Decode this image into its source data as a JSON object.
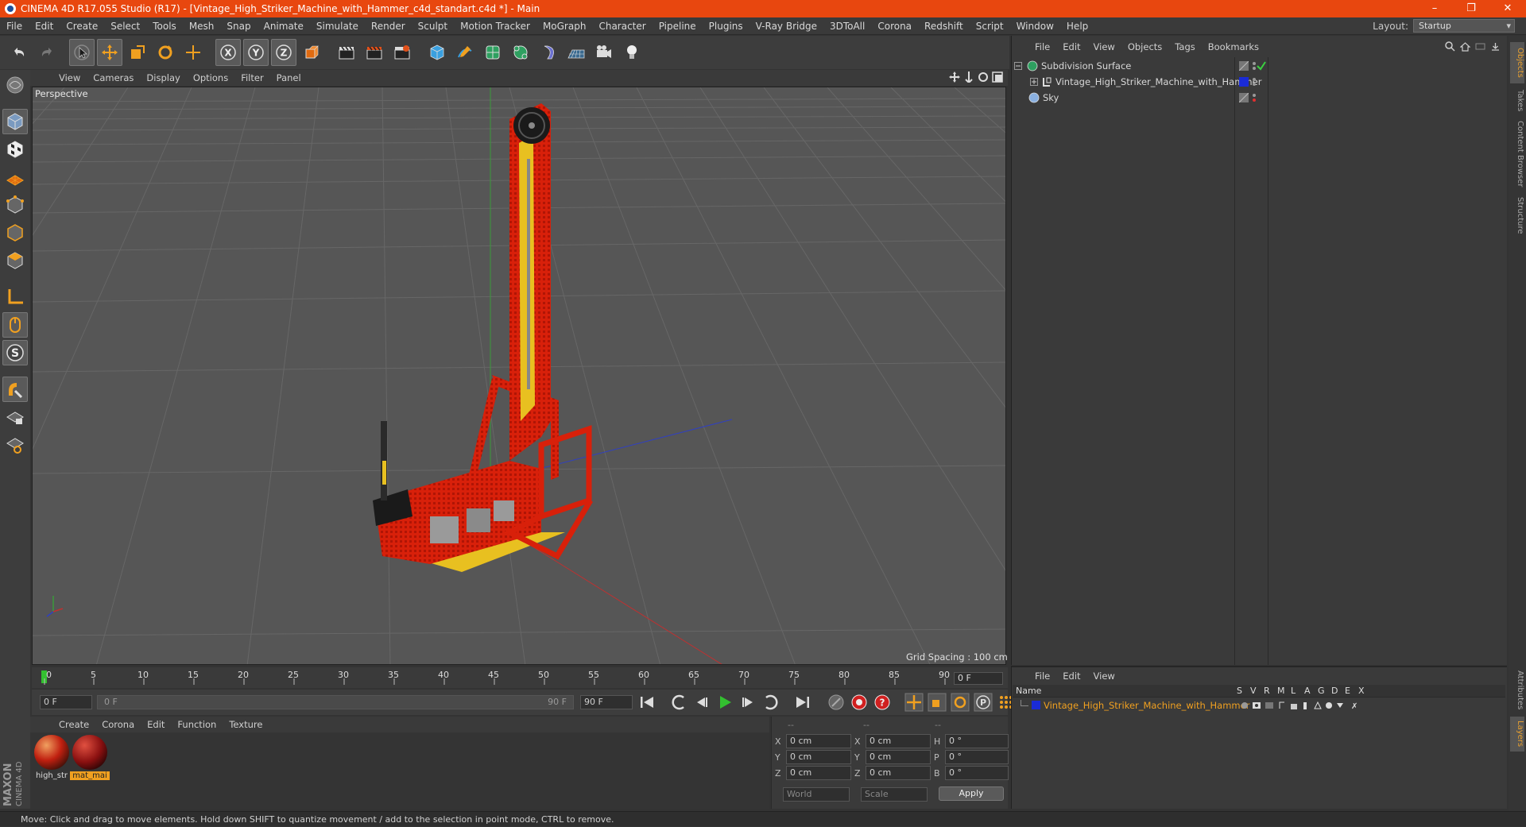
{
  "app": {
    "title": "CINEMA 4D R17.055 Studio (R17) - [Vintage_High_Striker_Machine_with_Hammer_c4d_standart.c4d *] - Main",
    "window_buttons": [
      "–",
      "❐",
      "✕"
    ]
  },
  "menubar": {
    "items": [
      "File",
      "Edit",
      "Create",
      "Select",
      "Tools",
      "Mesh",
      "Snap",
      "Animate",
      "Simulate",
      "Render",
      "Sculpt",
      "Motion Tracker",
      "MoGraph",
      "Character",
      "Pipeline",
      "Plugins",
      "V-Ray Bridge",
      "3DToAll",
      "Corona",
      "Redshift",
      "Script",
      "Window",
      "Help"
    ],
    "layout_label": "Layout:",
    "layout_value": "Startup"
  },
  "viewport": {
    "menu": [
      "View",
      "Cameras",
      "Display",
      "Options",
      "Filter",
      "Panel"
    ],
    "label": "Perspective",
    "grid_spacing": "Grid Spacing : 100 cm"
  },
  "timeline": {
    "ticks": [
      "0",
      "5",
      "10",
      "15",
      "20",
      "25",
      "30",
      "35",
      "40",
      "45",
      "50",
      "55",
      "60",
      "65",
      "70",
      "75",
      "80",
      "85",
      "90"
    ],
    "current_frame": "0 F",
    "start_field": "0 F",
    "range_start": "0 F",
    "range_end": "90 F",
    "end_field": "90 F"
  },
  "materials": {
    "menu": [
      "Create",
      "Corona",
      "Edit",
      "Function",
      "Texture"
    ],
    "items": [
      {
        "name": "high_str"
      },
      {
        "name": "mat_mai"
      }
    ]
  },
  "coordinates": {
    "headers": [
      "--",
      "--",
      "--"
    ],
    "rows": [
      {
        "a": "X",
        "v1": "0 cm",
        "b": "X",
        "v2": "0 cm",
        "c": "H",
        "v3": "0 °"
      },
      {
        "a": "Y",
        "v1": "0 cm",
        "b": "Y",
        "v2": "0 cm",
        "c": "P",
        "v3": "0 °"
      },
      {
        "a": "Z",
        "v1": "0 cm",
        "b": "Z",
        "v2": "0 cm",
        "c": "B",
        "v3": "0 °"
      }
    ],
    "mode1": "World",
    "mode2": "Scale",
    "apply": "Apply"
  },
  "object_manager": {
    "menu": [
      "File",
      "Edit",
      "View",
      "Objects",
      "Tags",
      "Bookmarks"
    ],
    "objects": [
      {
        "name": "Subdivision Surface"
      },
      {
        "name": "Vintage_High_Striker_Machine_with_Hammer"
      },
      {
        "name": "Sky"
      }
    ]
  },
  "layer_manager": {
    "menu": [
      "File",
      "Edit",
      "View"
    ],
    "columns": [
      "Name",
      "S",
      "V",
      "R",
      "M",
      "L",
      "A",
      "G",
      "D",
      "E",
      "X"
    ],
    "layer_name": "Vintage_High_Striker_Machine_with_Hammer"
  },
  "right_tabs": [
    "Objects",
    "Takes",
    "Content Browser",
    "Structure",
    "Attributes",
    "Layers"
  ],
  "status": "Move: Click and drag to move elements. Hold down SHIFT to quantize movement / add to the selection in point mode, CTRL to remove.",
  "brand": {
    "line1": "MAXON",
    "line2": "CINEMA 4D"
  },
  "colors": {
    "title_bar": "#e8470f",
    "accent_orange": "#f0a020",
    "layer_blue": "#1a2bd6"
  }
}
